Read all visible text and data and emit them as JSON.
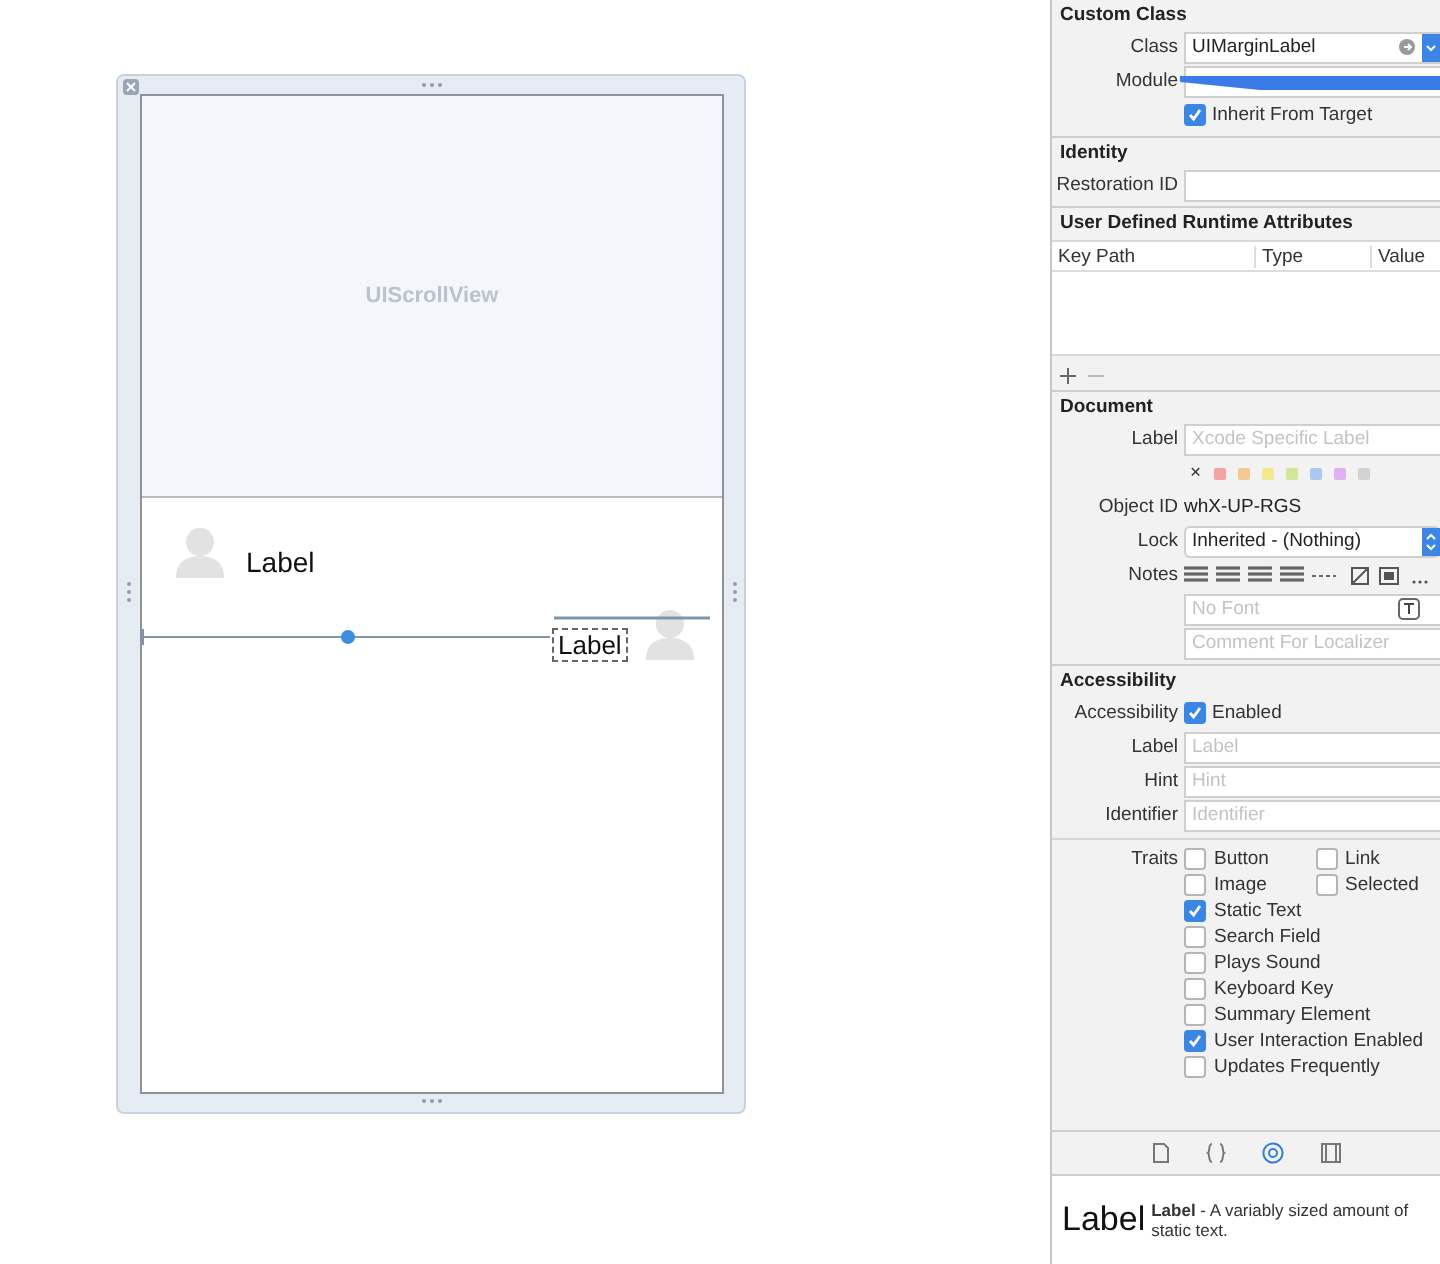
{
  "canvas": {
    "scroll_view_label": "UIScrollView",
    "labels": [
      {
        "text": "Label",
        "selected": false
      },
      {
        "text": "Label",
        "selected": true
      }
    ]
  },
  "inspector": {
    "custom_class": {
      "title": "Custom Class",
      "class_label": "Class",
      "class_value": "UIMarginLabel",
      "module_label": "Module",
      "inherit": {
        "label": "Inherit From Target",
        "checked": true
      }
    },
    "identity": {
      "title": "Identity",
      "restoration_label": "Restoration ID"
    },
    "runtime_attributes": {
      "title": "User Defined Runtime Attributes",
      "columns": [
        "Key Path",
        "Type",
        "Value"
      ]
    },
    "document": {
      "title": "Document",
      "label_label": "Label",
      "label_placeholder": "Xcode Specific Label",
      "clear": "×",
      "colors": [
        {
          "color": "#f2a4a4"
        },
        {
          "color": "#f5c992"
        },
        {
          "color": "#f3e88e"
        },
        {
          "color": "#cfe796"
        },
        {
          "color": "#a9c9f1"
        },
        {
          "color": "#dcb3ee"
        },
        {
          "color": "#d2d2d2"
        }
      ],
      "object_id_label": "Object ID",
      "object_id": "whX-UP-RGS",
      "lock_label": "Lock",
      "lock_value": "Inherited - (Nothing)",
      "notes_label": "Notes",
      "font_placeholder": "No Font",
      "comment_placeholder": "Comment For Localizer"
    },
    "accessibility": {
      "title": "Accessibility",
      "enabled_label": "Accessibility",
      "enabled": {
        "label": "Enabled",
        "checked": true
      },
      "fields": [
        {
          "label": "Label",
          "placeholder": "Label"
        },
        {
          "label": "Hint",
          "placeholder": "Hint"
        },
        {
          "label": "Identifier",
          "placeholder": "Identifier"
        }
      ],
      "traits_label": "Traits",
      "traits": [
        [
          {
            "label": "Button",
            "checked": false
          },
          {
            "label": "Link",
            "checked": false
          }
        ],
        [
          {
            "label": "Image",
            "checked": false
          },
          {
            "label": "Selected",
            "checked": false
          }
        ],
        [
          {
            "label": "Static Text",
            "checked": true
          }
        ],
        [
          {
            "label": "Search Field",
            "checked": false
          }
        ],
        [
          {
            "label": "Plays Sound",
            "checked": false
          }
        ],
        [
          {
            "label": "Keyboard Key",
            "checked": false
          }
        ],
        [
          {
            "label": "Summary Element",
            "checked": false
          }
        ],
        [
          {
            "label": "User Interaction Enabled",
            "checked": true
          }
        ],
        [
          {
            "label": "Updates Frequently",
            "checked": false
          }
        ]
      ]
    },
    "library_tabs": [
      {
        "kind": "file",
        "selected": false
      },
      {
        "kind": "braces",
        "selected": false
      },
      {
        "kind": "object",
        "selected": true
      },
      {
        "kind": "media",
        "selected": false
      }
    ],
    "library_item": {
      "preview": "Label",
      "description": "**Label** - A variably sized amount of static text."
    }
  }
}
